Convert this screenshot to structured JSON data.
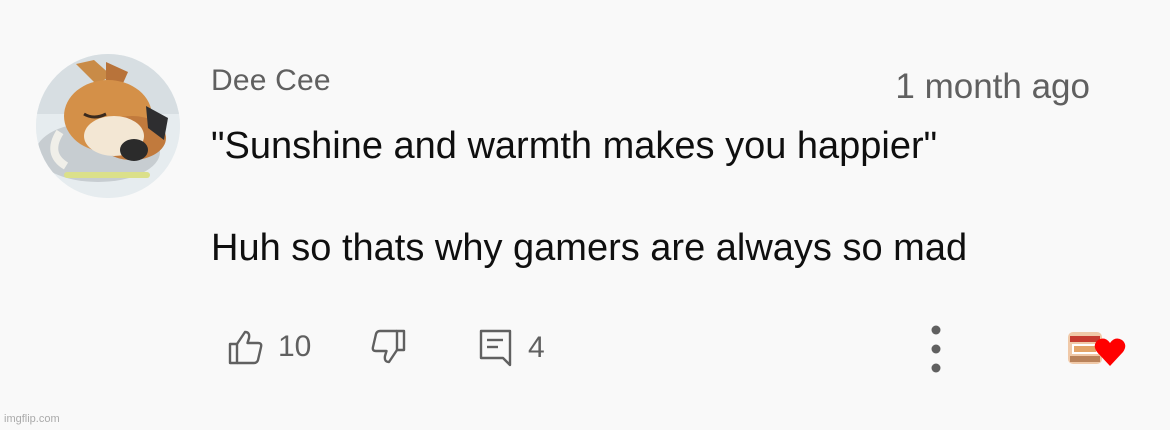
{
  "comment": {
    "author": "Dee Cee",
    "timestamp": "1 month ago",
    "lines": [
      "\"Sunshine and warmth makes you happier\"",
      "Huh so thats why gamers are always so mad"
    ]
  },
  "actions": {
    "like_count": "10",
    "reply_count": "4"
  },
  "icons": {
    "like": "thumbs-up-icon",
    "dislike": "thumbs-down-icon",
    "reply": "comment-icon",
    "more": "more-vert-icon",
    "creator_heart": "heart-icon"
  },
  "colors": {
    "background": "#f9f9f9",
    "text": "#0f0f0f",
    "secondary_text": "#606060",
    "heart": "#ff0000"
  },
  "watermark": "imgflip.com"
}
